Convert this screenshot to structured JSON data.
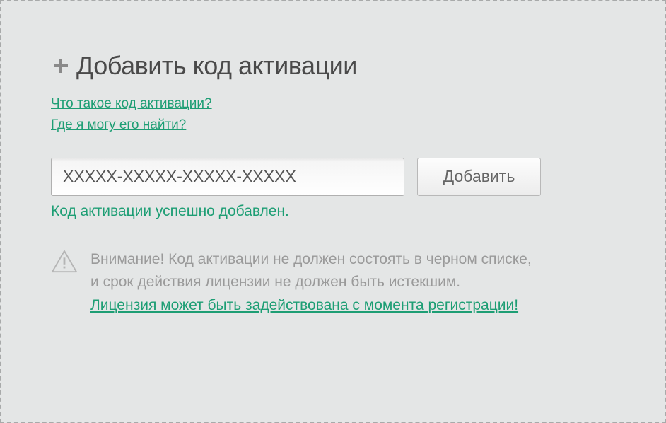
{
  "title": "Добавить код активации",
  "help_links": {
    "what_is_code": "Что такое код активации?",
    "where_find": "Где я могу его найти?"
  },
  "input": {
    "value": "XXXXX-XXXXX-XXXXX-XXXXX",
    "placeholder": ""
  },
  "add_button_label": "Добавить",
  "success_message": "Код активации успешно добавлен.",
  "warning": {
    "line1": "Внимание! Код активации не должен состоять в черном списке,",
    "line2": "и срок действия лицензии не должен быть истекшим.",
    "link": "Лицензия может быть задействована с момента регистрации!"
  }
}
